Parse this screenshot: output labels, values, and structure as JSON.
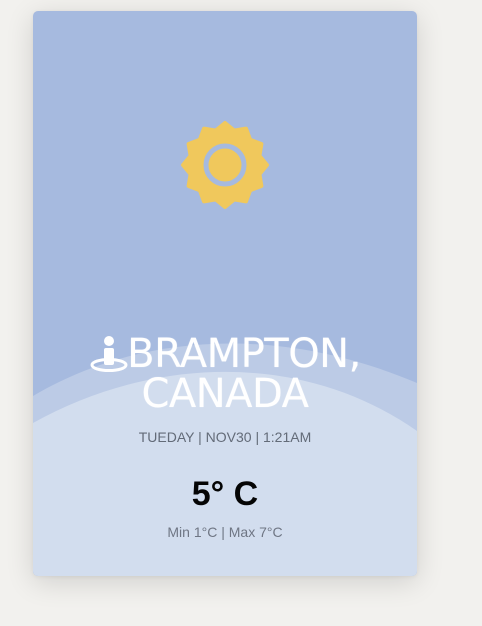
{
  "weather": {
    "icon": "sun-icon",
    "location_line1": "BRAMPTON,",
    "location_line2": "CANADA",
    "datetime": "TUEDAY | NOV30 | 1:21AM",
    "temperature": "5° C",
    "min_max": "Min 1°C | Max 7°C"
  },
  "colors": {
    "sky": "#a6badf",
    "hill_back": "#bccbe6",
    "hill_front": "#d2ddee",
    "sun": "#f0c85c"
  }
}
